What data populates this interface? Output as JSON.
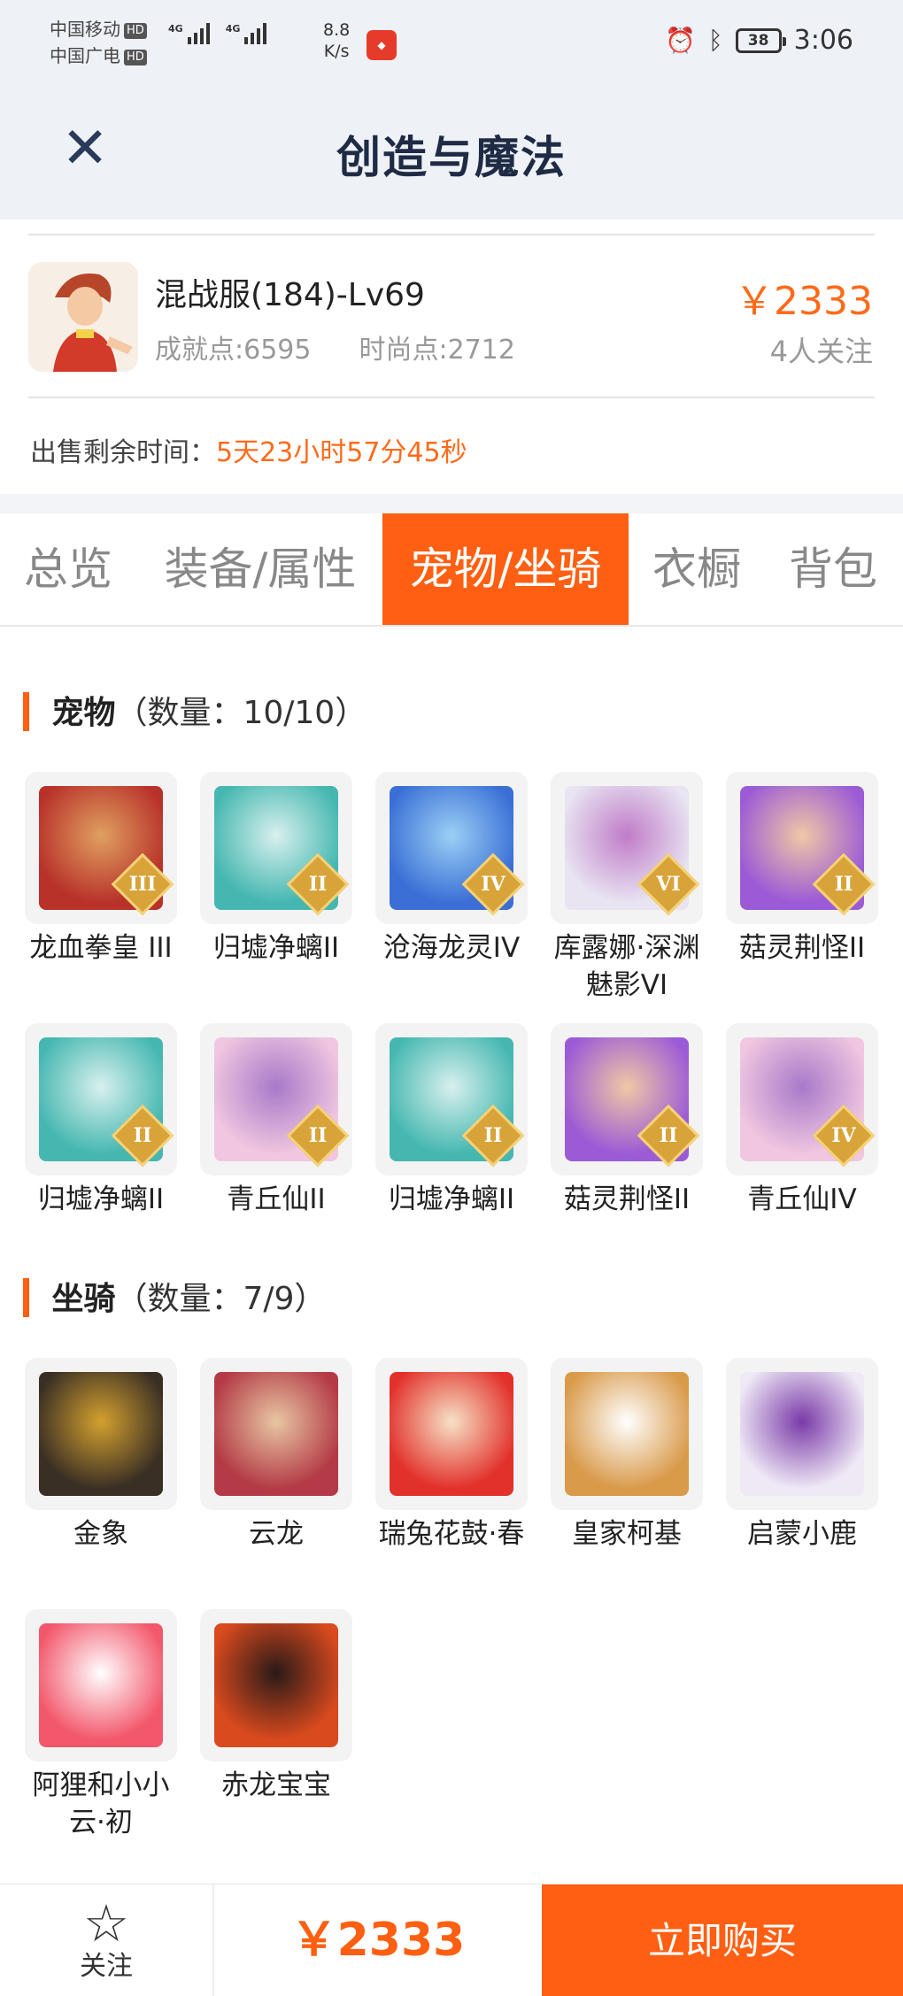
{
  "status_bar": {
    "carrier1": "中国移动",
    "carrier2": "中国广电",
    "hd": "HD",
    "net1": "4G",
    "net2": "4G",
    "speed_value": "8.8",
    "speed_unit": "K/s",
    "battery": "38",
    "time": "3:06"
  },
  "header": {
    "title": "创造与魔法"
  },
  "listing": {
    "server": "混战服(184)-Lv69",
    "achievement": "成就点:6595",
    "fashion": "时尚点:2712",
    "price": "￥2333",
    "followers": "4人关注",
    "remaining_label": "出售剩余时间：",
    "remaining_value": "5天23小时57分45秒"
  },
  "tabs": [
    {
      "label": "总览"
    },
    {
      "label": "装备/属性"
    },
    {
      "label": "宠物/坐骑",
      "active": true
    },
    {
      "label": "衣橱"
    },
    {
      "label": "背包"
    }
  ],
  "pets": {
    "title": "宠物",
    "count": "（数量：10/10）",
    "items": [
      {
        "name": "龙血拳皇 III",
        "tier": "III",
        "icon": "red-bull-warrior"
      },
      {
        "name": "归墟净螭II",
        "tier": "II",
        "icon": "cyan-dragon"
      },
      {
        "name": "沧海龙灵IV",
        "tier": "IV",
        "icon": "blue-dragon-spirit"
      },
      {
        "name": "库露娜·深渊魅影VI",
        "tier": "VI",
        "icon": "white-haired-girl"
      },
      {
        "name": "菇灵荆怪II",
        "tier": "II",
        "icon": "purple-mushroom-imp"
      },
      {
        "name": "归墟净螭II",
        "tier": "II",
        "icon": "cyan-dragon"
      },
      {
        "name": "青丘仙II",
        "tier": "II",
        "icon": "fox-fairy"
      },
      {
        "name": "归墟净螭II",
        "tier": "II",
        "icon": "cyan-dragon"
      },
      {
        "name": "菇灵荆怪II",
        "tier": "II",
        "icon": "purple-mushroom-imp"
      },
      {
        "name": "青丘仙IV",
        "tier": "IV",
        "icon": "fox-fairy"
      }
    ]
  },
  "mounts": {
    "title": "坐骑",
    "count": "（数量：7/9）",
    "items": [
      {
        "name": "金象",
        "icon": "golden-elephant"
      },
      {
        "name": "云龙",
        "icon": "cloud-dragon"
      },
      {
        "name": "瑞兔花鼓·春",
        "icon": "rabbit-drum"
      },
      {
        "name": "皇家柯基",
        "icon": "royal-corgi"
      },
      {
        "name": "启蒙小鹿",
        "icon": "white-deer"
      },
      {
        "name": "阿狸和小小云·初",
        "icon": "ali-fox-cloud"
      },
      {
        "name": "赤龙宝宝",
        "icon": "red-baby-dragon"
      }
    ]
  },
  "bottom_bar": {
    "follow": "关注",
    "price": "￥2333",
    "buy": "立即购买"
  },
  "colors": {
    "accent": "#ff5f12",
    "price": "#ff6a1a",
    "header_bg": "#eef2f7"
  }
}
